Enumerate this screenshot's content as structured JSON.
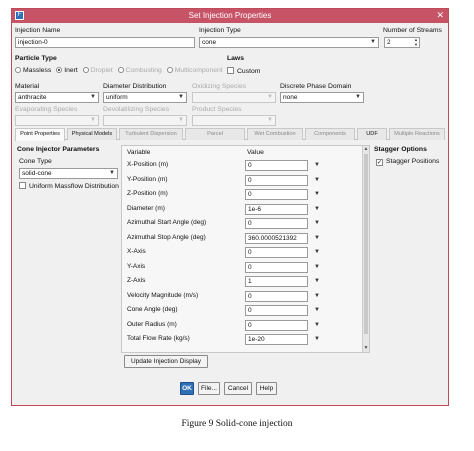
{
  "window": {
    "title": "Set Injection Properties",
    "icon": "fluent-app-icon",
    "close_glyph": "✕"
  },
  "injection_name": {
    "label": "Injection Name",
    "value": "injection-0"
  },
  "injection_type": {
    "label": "Injection Type",
    "value": "cone"
  },
  "number_of_streams": {
    "label": "Number of Streams",
    "value": "2"
  },
  "particle_type": {
    "label": "Particle Type",
    "options": [
      "Massless",
      "Inert",
      "Droplet",
      "Combusting",
      "Multicomponent"
    ],
    "selected": "Inert"
  },
  "laws": {
    "label": "Laws",
    "custom_label": "Custom"
  },
  "material": {
    "label": "Material",
    "value": "anthracite"
  },
  "diameter_distribution": {
    "label": "Diameter Distribution",
    "value": "uniform"
  },
  "oxidizing_species": {
    "label": "Oxidizing Species",
    "value": ""
  },
  "discrete_phase_domain": {
    "label": "Discrete Phase Domain",
    "value": "none"
  },
  "evaporating_species": {
    "label": "Evaporating Species",
    "value": ""
  },
  "devolatilizing_species": {
    "label": "Devolatilizing Species",
    "value": ""
  },
  "product_species": {
    "label": "Product Species",
    "value": ""
  },
  "tabs": [
    {
      "label": "Point Properties"
    },
    {
      "label": "Physical Models"
    },
    {
      "label": "Turbulent Dispersion"
    },
    {
      "label": "Parcel"
    },
    {
      "label": "Wet Combustion"
    },
    {
      "label": "Components"
    },
    {
      "label": "UDF"
    },
    {
      "label": "Multiple Reactions"
    }
  ],
  "cone_params": {
    "heading": "Cone Injector Parameters",
    "cone_type_label": "Cone Type",
    "cone_type_value": "solid-cone",
    "uniform_massflow_label": "Uniform Massflow Distribution"
  },
  "table": {
    "col_variable": "Variable",
    "col_value": "Value",
    "rows": [
      {
        "variable": "X-Position (m)",
        "value": "0"
      },
      {
        "variable": "Y-Position (m)",
        "value": "0"
      },
      {
        "variable": "Z-Position (m)",
        "value": "0"
      },
      {
        "variable": "Diameter (m)",
        "value": "1e-6"
      },
      {
        "variable": "Azimuthal Start Angle (deg)",
        "value": "0"
      },
      {
        "variable": "Azimuthal Stop Angle (deg)",
        "value": "360.0000521392"
      },
      {
        "variable": "X-Axis",
        "value": "0"
      },
      {
        "variable": "Y-Axis",
        "value": "0"
      },
      {
        "variable": "Z-Axis",
        "value": "1"
      },
      {
        "variable": "Velocity Magnitude (m/s)",
        "value": "0"
      },
      {
        "variable": "Cone Angle (deg)",
        "value": "0"
      },
      {
        "variable": "Outer Radius (m)",
        "value": "0"
      },
      {
        "variable": "Total Flow Rate (kg/s)",
        "value": "1e-20"
      }
    ],
    "update_button": "Update Injection Display"
  },
  "stagger": {
    "heading": "Stagger Options",
    "positions_label": "Stagger Positions",
    "positions_checked": true
  },
  "buttons": {
    "ok": "OK",
    "file": "File...",
    "cancel": "Cancel",
    "help": "Help"
  },
  "caption": "Figure 9 Solid-cone injection",
  "colors": {
    "titlebar": "#c75366",
    "ok_button": "#2f6fb5"
  }
}
